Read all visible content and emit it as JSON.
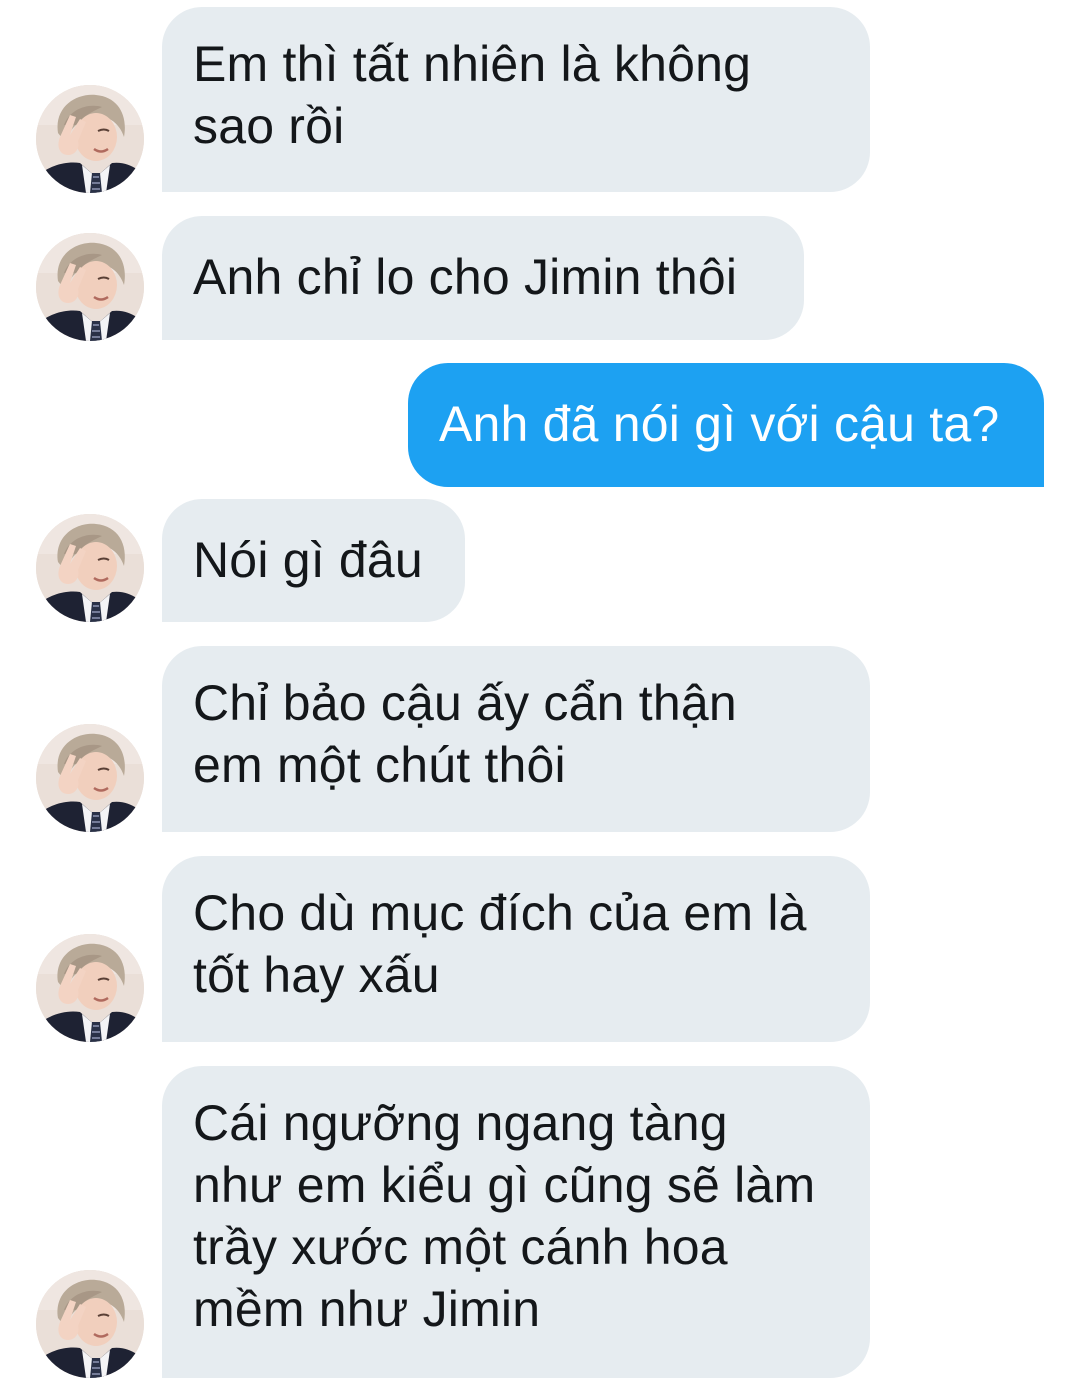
{
  "conversation": {
    "colors": {
      "incoming_bubble": "#e6ecf0",
      "outgoing_bubble": "#1da1f2",
      "incoming_text": "#14171a",
      "outgoing_text": "#ffffff"
    },
    "messages": [
      {
        "direction": "incoming",
        "text": "Em thì tất nhiên là không\nsao rồi"
      },
      {
        "direction": "incoming",
        "text": "Anh chỉ lo cho Jimin thôi"
      },
      {
        "direction": "outgoing",
        "text": "Anh đã nói gì với cậu ta?"
      },
      {
        "direction": "incoming",
        "text": "Nói gì đâu"
      },
      {
        "direction": "incoming",
        "text": "Chỉ bảo cậu ấy cẩn thận\nem một chút thôi"
      },
      {
        "direction": "incoming",
        "text": "Cho dù mục đích của em là\ntốt hay xấu"
      },
      {
        "direction": "incoming",
        "text": "Cái ngưỡng ngang tàng\nnhư em kiểu gì cũng sẽ làm\ntrầy xước một cánh hoa\nmềm như Jimin"
      }
    ]
  }
}
